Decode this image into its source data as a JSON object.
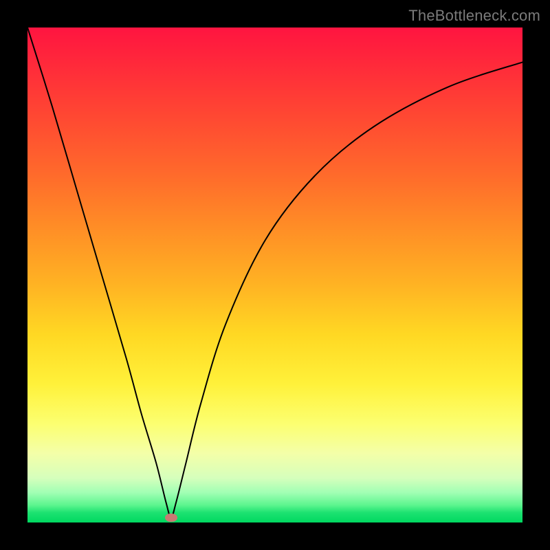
{
  "watermark": {
    "text": "TheBottleneck.com"
  },
  "chart_data": {
    "type": "line",
    "title": "",
    "xlabel": "",
    "ylabel": "",
    "xlim": [
      0,
      100
    ],
    "ylim": [
      0,
      100
    ],
    "marker": {
      "x": 29,
      "y": 1
    },
    "series": [
      {
        "name": "curve",
        "x": [
          0,
          5,
          10,
          15,
          20,
          23,
          26,
          28,
          29,
          30,
          32,
          35,
          40,
          48,
          58,
          70,
          85,
          100
        ],
        "values": [
          100,
          84,
          67,
          50,
          33,
          22,
          12,
          4,
          1,
          4,
          12,
          24,
          40,
          57,
          70,
          80,
          88,
          93
        ]
      }
    ],
    "grid": false,
    "legend": false,
    "background": "gradient-red-to-green"
  }
}
